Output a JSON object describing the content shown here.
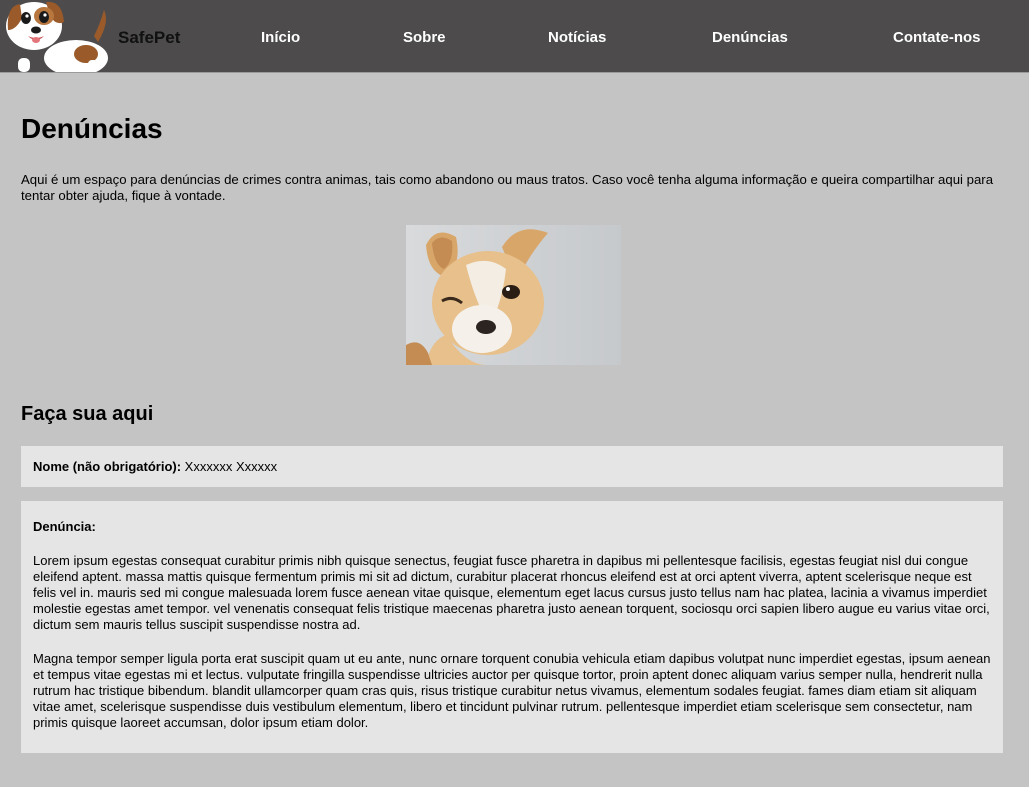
{
  "header": {
    "brand": "SafePet",
    "nav": [
      {
        "label": "Início"
      },
      {
        "label": "Sobre"
      },
      {
        "label": "Notícias"
      },
      {
        "label": "Denúncias"
      },
      {
        "label": "Contate-nos"
      }
    ]
  },
  "main": {
    "title": "Denúncias",
    "intro": "Aqui é um espaço para denúncias de crimes contra animas, tais como abandono ou maus tratos. Caso você tenha alguma informação e queira compartilhar aqui para tentar obter ajuda, fique à vontade.",
    "form_title": "Faça sua aqui",
    "name_label": "Nome (não obrigatório):",
    "name_value": "Xxxxxxx Xxxxxx",
    "report_label": "Denúncia:",
    "paragraphs": [
      "Lorem ipsum egestas consequat curabitur primis nibh quisque senectus, feugiat fusce pharetra in dapibus mi pellentesque facilisis, egestas feugiat nisl dui congue eleifend aptent. massa mattis quisque fermentum primis mi sit ad dictum, curabitur placerat rhoncus eleifend est at orci aptent viverra, aptent scelerisque neque est felis vel in. mauris sed mi congue malesuada lorem fusce aenean vitae quisque, elementum eget lacus cursus justo tellus nam hac platea, lacinia a vivamus imperdiet molestie egestas amet tempor. vel venenatis consequat felis tristique maecenas pharetra justo aenean torquent, sociosqu orci sapien libero augue eu varius vitae orci, dictum sem mauris tellus suscipit suspendisse nostra ad.",
      "Magna tempor semper ligula porta erat suscipit quam ut eu ante, nunc ornare torquent conubia vehicula etiam dapibus volutpat nunc imperdiet egestas, ipsum aenean et tempus vitae egestas mi et lectus. vulputate fringilla suspendisse ultricies auctor per quisque tortor, proin aptent donec aliquam varius semper nulla, hendrerit nulla rutrum hac tristique bibendum. blandit ullamcorper quam cras quis, risus tristique curabitur netus vivamus, elementum sodales feugiat. fames diam etiam sit aliquam vitae amet, scelerisque suspendisse duis vestibulum elementum, libero et tincidunt pulvinar rutrum. pellentesque imperdiet etiam scelerisque sem consectetur, nam primis quisque laoreet accumsan, dolor ipsum etiam dolor."
    ]
  },
  "colors": {
    "navbar": "#4d4b4c",
    "page_background": "#c4c4c4",
    "box_background": "#e5e5e5",
    "nav_text": "#ffffff"
  },
  "icons": {
    "logo": "cartoon-dog-logo",
    "photo": "winking-chihuahua-photo"
  }
}
